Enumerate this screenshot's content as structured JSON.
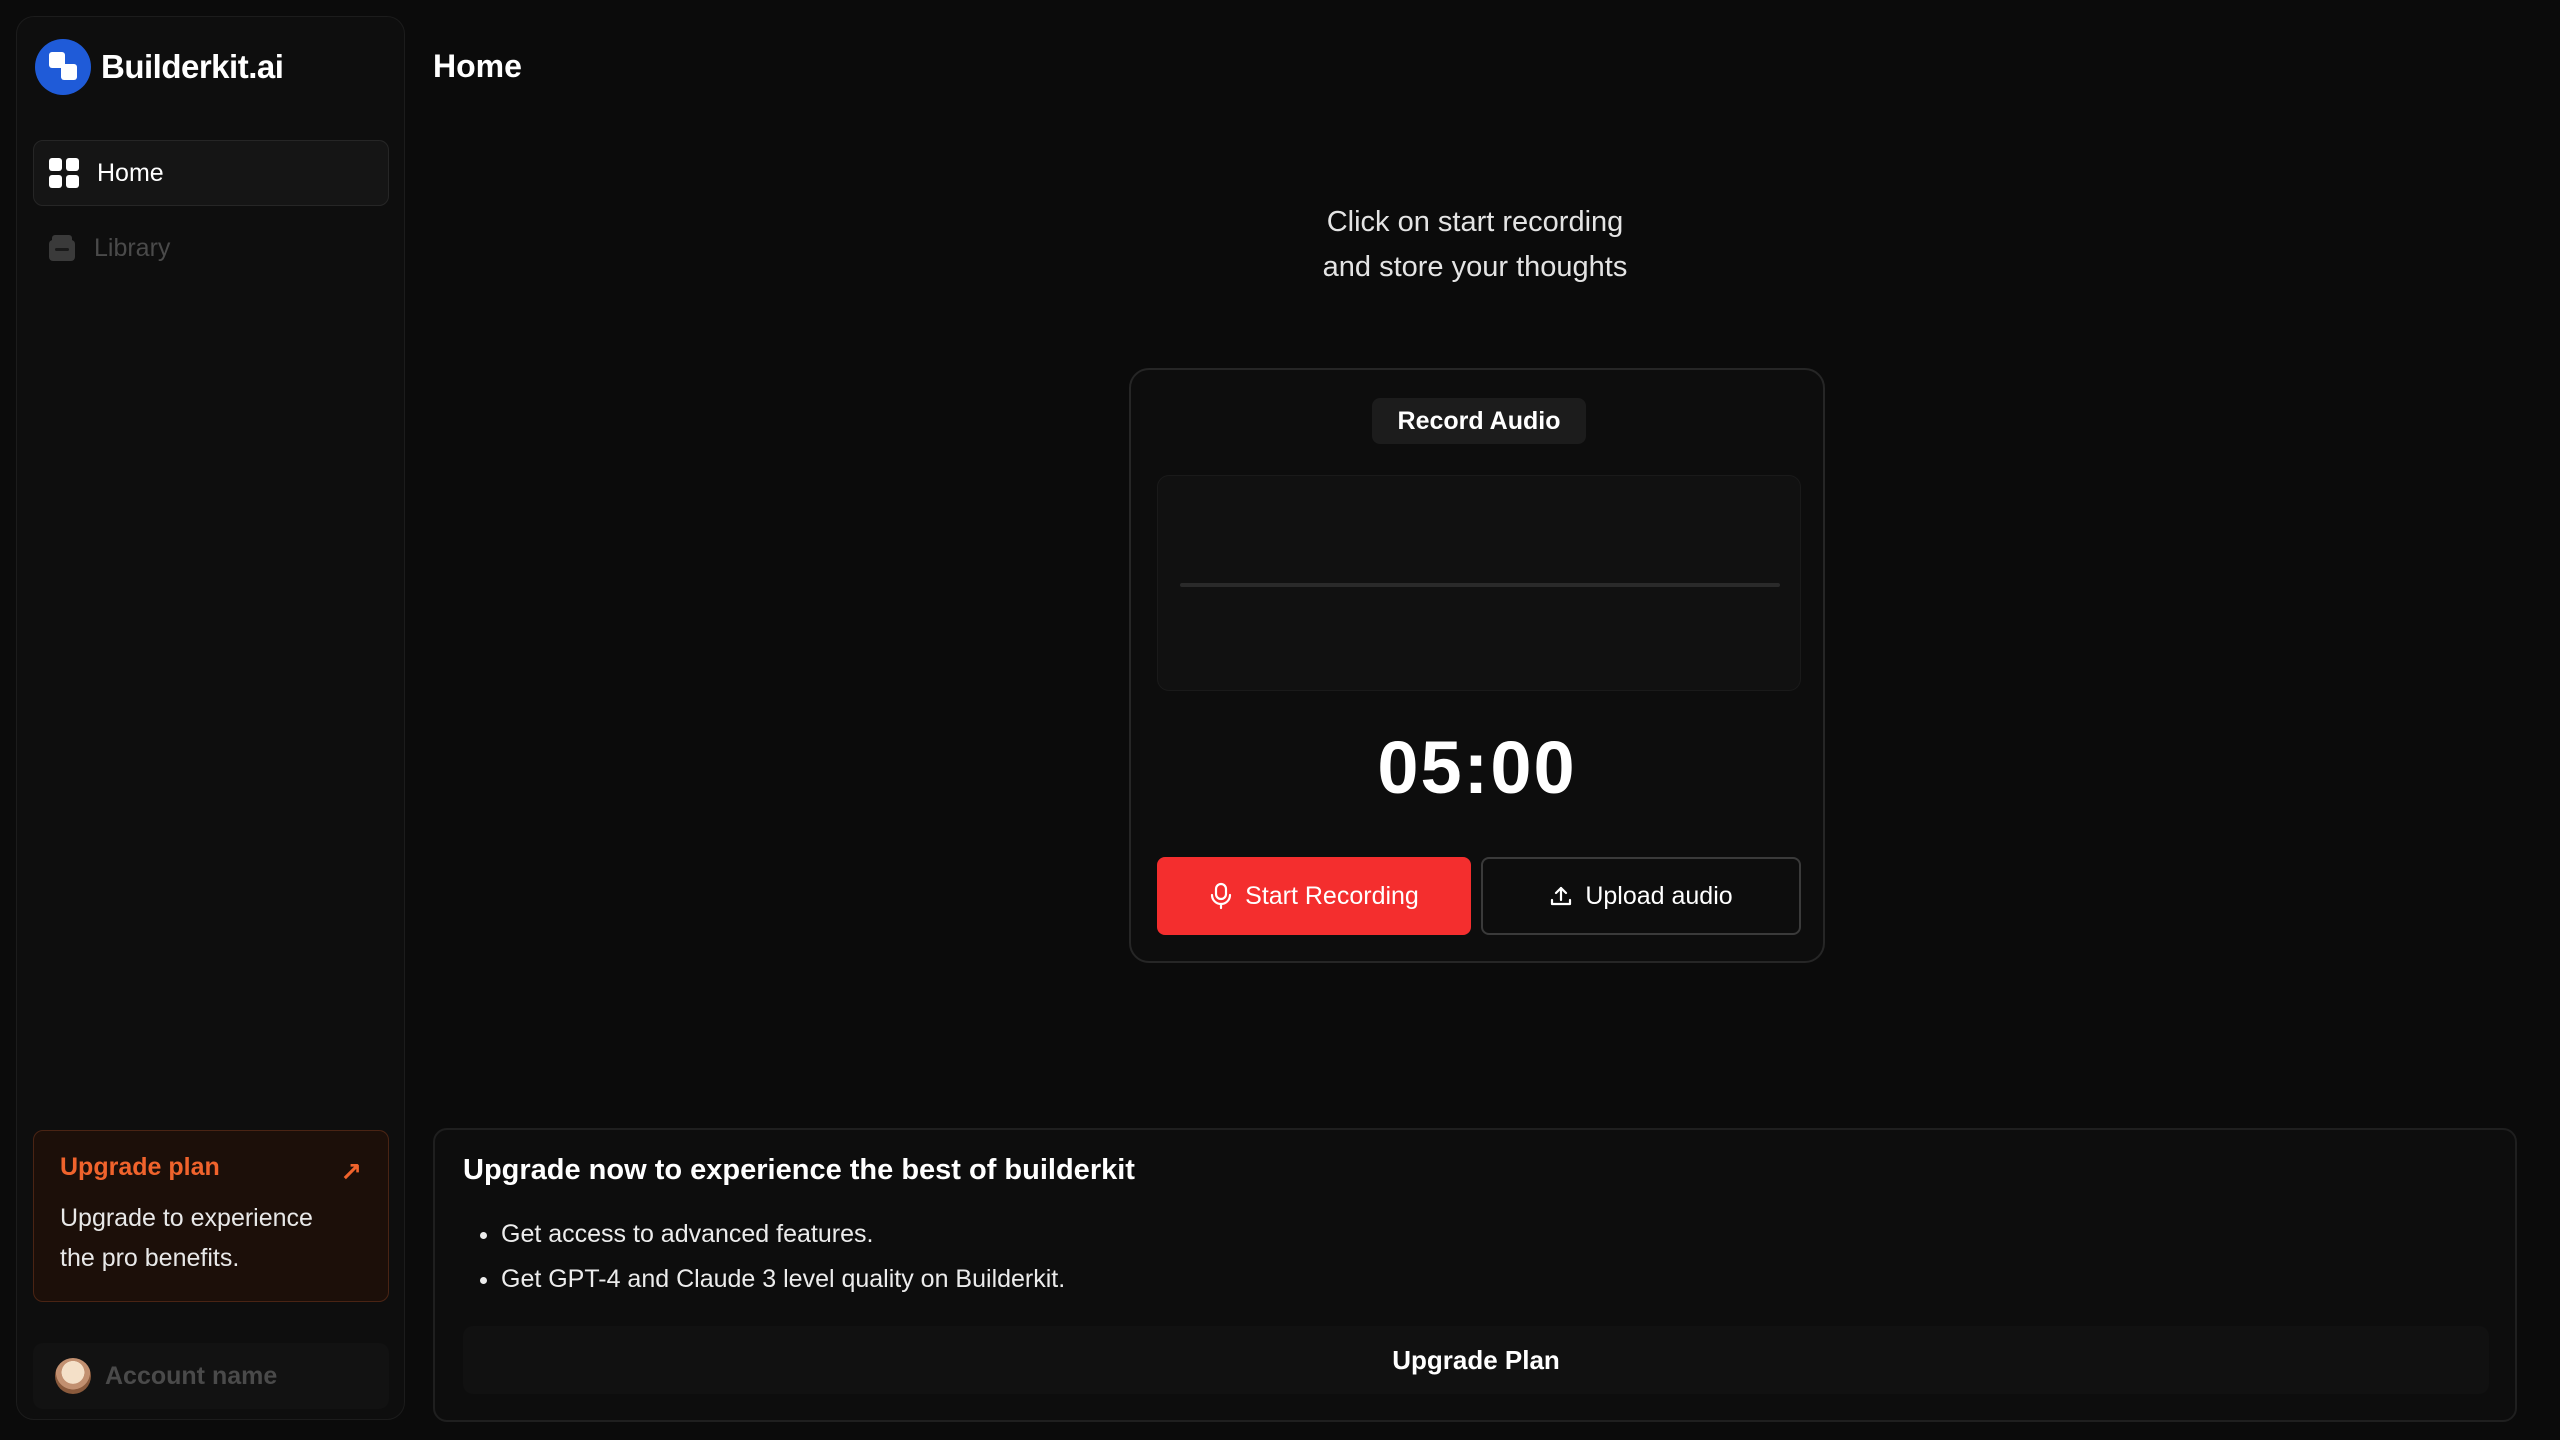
{
  "brand": {
    "name": "Builderkit.ai",
    "logo_icon": "builderkit-logo-icon"
  },
  "sidebar": {
    "items": [
      {
        "label": "Home",
        "icon": "grid-icon",
        "active": true
      },
      {
        "label": "Library",
        "icon": "archive-icon",
        "active": false
      }
    ],
    "upgrade_card": {
      "title": "Upgrade plan",
      "arrow": "↗",
      "description": "Upgrade to experience the pro benefits."
    },
    "account": {
      "name": "Account name"
    }
  },
  "header": {
    "title": "Home"
  },
  "main": {
    "prompt_line1": "Click on start recording",
    "prompt_line2": "and store your thoughts",
    "recorder": {
      "badge": "Record Audio",
      "timer": "05:00",
      "start_label": "Start Recording",
      "upload_label": "Upload audio"
    }
  },
  "promo": {
    "title": "Upgrade now to experience the best of builderkit",
    "bullets": [
      "Get access to advanced features.",
      "Get GPT-4 and Claude 3 level quality on Builderkit."
    ],
    "button_label": "Upgrade Plan"
  },
  "colors": {
    "accent_red": "#f42e2e",
    "upgrade_orange": "#f0632c",
    "brand_blue": "#1f5bd8",
    "background": "#0b0b0b"
  }
}
